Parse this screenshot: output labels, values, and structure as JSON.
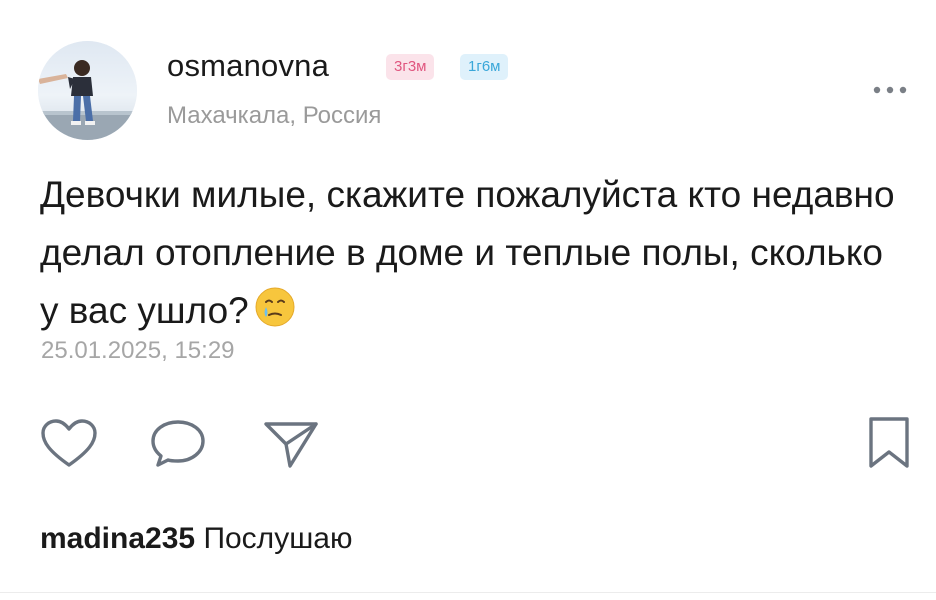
{
  "post": {
    "author": {
      "username": "osmanovna",
      "badge_1": "3г3м",
      "badge_2": "1г6м",
      "location": "Махачкала, Россия"
    },
    "text": "Девочки милые, скажите пожалуйста кто недавно делал отопление в доме и теплые полы, сколько у вас ушло?",
    "emoji": "face-holding-back-tears",
    "date": "25.01.2025, 15:29",
    "actions": [
      "like-icon",
      "comment-icon",
      "share-icon",
      "bookmark-icon"
    ]
  },
  "comment_preview": {
    "author": "madina235",
    "text": "Послушаю"
  },
  "colors": {
    "badge_1_bg": "#fbe3ea",
    "badge_1_text": "#e0567f",
    "badge_2_bg": "#dff1fb",
    "badge_2_text": "#3aa7d9",
    "secondary_text": "#9a9a9a",
    "icon_stroke": "#6b7480"
  }
}
